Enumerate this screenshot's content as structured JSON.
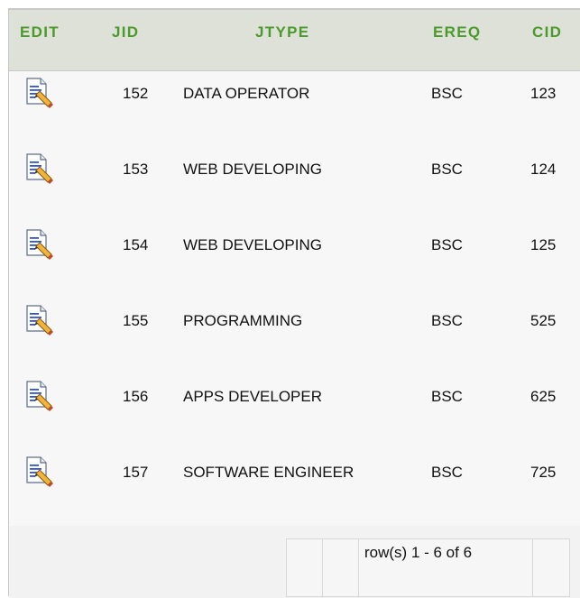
{
  "table": {
    "headers": {
      "edit": "EDIT",
      "jid": "JID",
      "jtype": "JTYPE",
      "ereq": "EREQ",
      "cid": "CID"
    },
    "rows": [
      {
        "jid": "152",
        "jtype": "DATA OPERATOR",
        "ereq": "BSC",
        "cid": "123"
      },
      {
        "jid": "153",
        "jtype": "WEB DEVELOPING",
        "ereq": "BSC",
        "cid": "124"
      },
      {
        "jid": "154",
        "jtype": "WEB DEVELOPING",
        "ereq": "BSC",
        "cid": "125"
      },
      {
        "jid": "155",
        "jtype": "PROGRAMMING",
        "ereq": "BSC",
        "cid": "525"
      },
      {
        "jid": "156",
        "jtype": "APPS DEVELOPER",
        "ereq": "BSC",
        "cid": "625"
      },
      {
        "jid": "157",
        "jtype": "SOFTWARE ENGINEER",
        "ereq": "BSC",
        "cid": "725"
      }
    ]
  },
  "pagination": {
    "label": "row(s) 1 - 6 of 6"
  },
  "icons": {
    "edit": "edit-document-pencil-icon"
  },
  "colors": {
    "header_text": "#4b9a2b",
    "header_bg": "#dde1d8",
    "row_bg": "#f7f7f7"
  }
}
